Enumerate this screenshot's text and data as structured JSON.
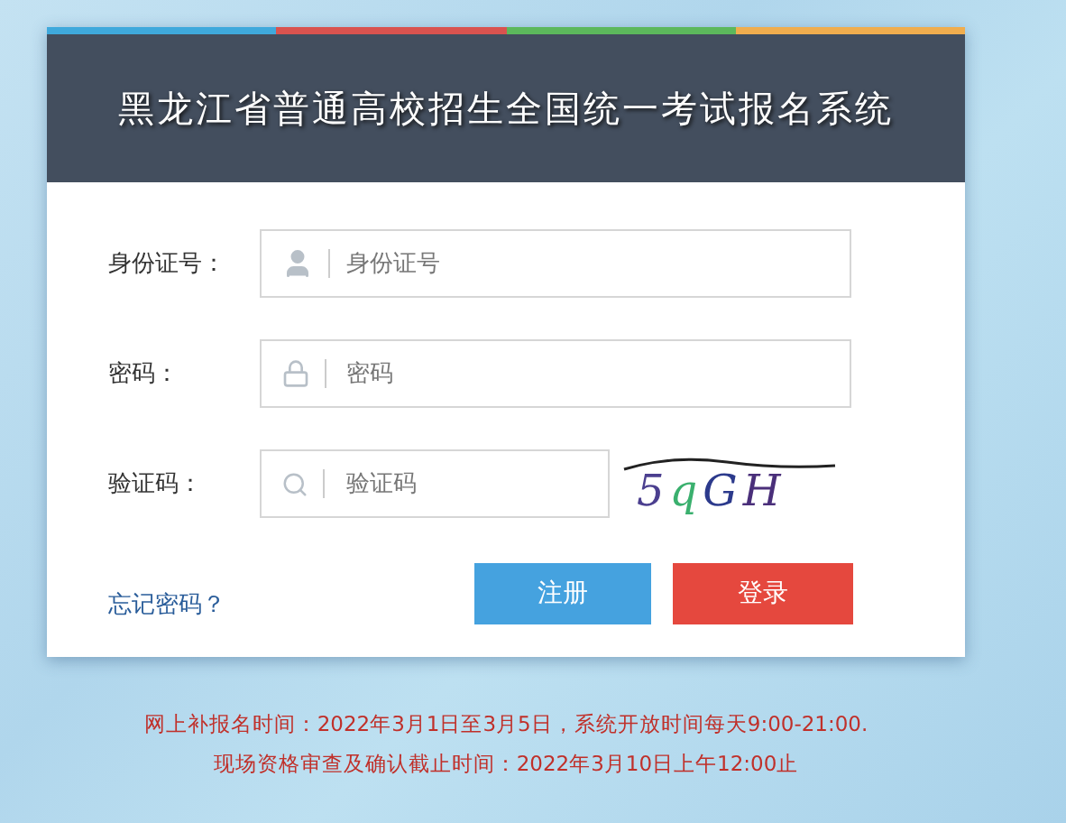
{
  "header": {
    "title": "黑龙江省普通高校招生全国统一考试报名系统"
  },
  "fields": [
    {
      "kind": "user",
      "label": "身份证号：",
      "placeholder": "身份证号"
    },
    {
      "kind": "password",
      "label": "密码：",
      "placeholder": "密码"
    },
    {
      "kind": "captcha",
      "label": "验证码：",
      "placeholder": "验证码"
    }
  ],
  "captcha": {
    "text": "5qGH"
  },
  "forgot_link": "忘记密码？",
  "buttons": [
    {
      "kind": "register",
      "label": "注册"
    },
    {
      "kind": "login",
      "label": "登录"
    }
  ],
  "notices": [
    "网上补报名时间：2022年3月1日至3月5日，系统开放时间每天9:00-21:00.",
    "现场资格审查及确认截止时间：2022年3月10日上午12:00止"
  ]
}
